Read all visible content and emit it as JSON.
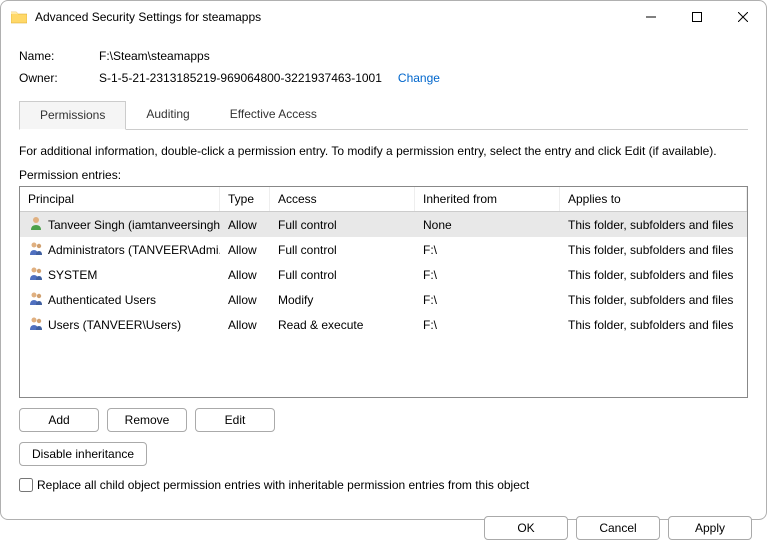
{
  "window": {
    "title": "Advanced Security Settings for steamapps"
  },
  "info": {
    "name_label": "Name:",
    "name_value": "F:\\Steam\\steamapps",
    "owner_label": "Owner:",
    "owner_value": "S-1-5-21-2313185219-969064800-3221937463-1001",
    "change_label": "Change"
  },
  "tabs": {
    "permissions": "Permissions",
    "auditing": "Auditing",
    "effective": "Effective Access"
  },
  "help_text": "For additional information, double-click a permission entry. To modify a permission entry, select the entry and click Edit (if available).",
  "section_label": "Permission entries:",
  "columns": {
    "principal": "Principal",
    "type": "Type",
    "access": "Access",
    "inherited": "Inherited from",
    "applies": "Applies to"
  },
  "entries": [
    {
      "principal": "Tanveer Singh (iamtanveersingh...",
      "type": "Allow",
      "access": "Full control",
      "inherited": "None",
      "applies": "This folder, subfolders and files",
      "icon": "single"
    },
    {
      "principal": "Administrators (TANVEER\\Admi...",
      "type": "Allow",
      "access": "Full control",
      "inherited": "F:\\",
      "applies": "This folder, subfolders and files",
      "icon": "group"
    },
    {
      "principal": "SYSTEM",
      "type": "Allow",
      "access": "Full control",
      "inherited": "F:\\",
      "applies": "This folder, subfolders and files",
      "icon": "group"
    },
    {
      "principal": "Authenticated Users",
      "type": "Allow",
      "access": "Modify",
      "inherited": "F:\\",
      "applies": "This folder, subfolders and files",
      "icon": "group"
    },
    {
      "principal": "Users (TANVEER\\Users)",
      "type": "Allow",
      "access": "Read & execute",
      "inherited": "F:\\",
      "applies": "This folder, subfolders and files",
      "icon": "group"
    }
  ],
  "buttons": {
    "add": "Add",
    "remove": "Remove",
    "edit": "Edit",
    "disable": "Disable inheritance",
    "ok": "OK",
    "cancel": "Cancel",
    "apply": "Apply"
  },
  "checkbox_label": "Replace all child object permission entries with inheritable permission entries from this object"
}
